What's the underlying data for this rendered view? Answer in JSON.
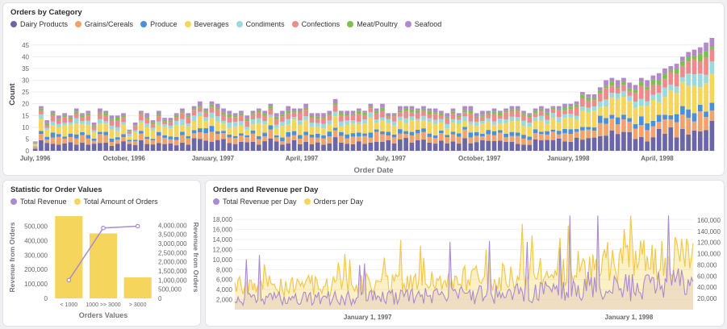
{
  "top": {
    "title": "Orders by Category",
    "legend": [
      {
        "label": "Dairy Products",
        "color": "#6b66a8"
      },
      {
        "label": "Grains/Cereals",
        "color": "#f2a36b"
      },
      {
        "label": "Produce",
        "color": "#4a90d9"
      },
      {
        "label": "Beverages",
        "color": "#f6d55c"
      },
      {
        "label": "Condiments",
        "color": "#9ad9dc"
      },
      {
        "label": "Confections",
        "color": "#ee8a8a"
      },
      {
        "label": "Meat/Poultry",
        "color": "#7fbf50"
      },
      {
        "label": "Seafood",
        "color": "#b389cc"
      }
    ]
  },
  "left": {
    "title": "Statistic for Order Values",
    "legend": [
      {
        "label": "Total Revenue",
        "color": "#a98bd0"
      },
      {
        "label": "Total Amount of Orders",
        "color": "#f6d55c"
      }
    ]
  },
  "right": {
    "title": "Orders and Revenue per Day",
    "legend": [
      {
        "label": "Total Revenue per Day",
        "color": "#a98bd0"
      },
      {
        "label": "Orders per Day",
        "color": "#f6d55c"
      }
    ]
  },
  "chart_data": [
    {
      "type": "bar",
      "stacked": true,
      "title": "Orders by Category",
      "xlabel": "Order Date",
      "ylabel": "Count",
      "ylim": [
        0,
        48
      ],
      "y_ticks": [
        0,
        5,
        10,
        15,
        20,
        25,
        30,
        35,
        40,
        45
      ],
      "x_tick_labels": [
        "July, 1996",
        "October, 1996",
        "January, 1997",
        "April, 1997",
        "July, 1997",
        "October, 1997",
        "January, 1998",
        "April, 1998"
      ],
      "series_names": [
        "Dairy Products",
        "Grains/Cereals",
        "Produce",
        "Beverages",
        "Condiments",
        "Confections",
        "Meat/Poultry",
        "Seafood"
      ],
      "totals": [
        4,
        19,
        13,
        17,
        15,
        16,
        15,
        18,
        16,
        17,
        12,
        18,
        17,
        15,
        15,
        16,
        9,
        12,
        17,
        16,
        13,
        17,
        14,
        14,
        16,
        18,
        16,
        19,
        21,
        18,
        21,
        20,
        18,
        17,
        16,
        17,
        15,
        17,
        18,
        17,
        20,
        16,
        17,
        19,
        18,
        18,
        20,
        16,
        16,
        16,
        17,
        22,
        17,
        17,
        17,
        18,
        17,
        20,
        18,
        20,
        16,
        16,
        19,
        19,
        19,
        18,
        19,
        18,
        18,
        17,
        16,
        18,
        16,
        19,
        19,
        16,
        17,
        17,
        18,
        17,
        18,
        19,
        19,
        17,
        16,
        18,
        19,
        18,
        19,
        19,
        20,
        20,
        21,
        25,
        24,
        24,
        27,
        30,
        31,
        30,
        31,
        29,
        28,
        31,
        30,
        32,
        33,
        35,
        36,
        37,
        40,
        42,
        43,
        44,
        46,
        48
      ]
    },
    {
      "type": "bar",
      "title": "Statistic for Order Values",
      "xlabel": "Orders Values",
      "ylabel": "Revenue from Orders",
      "y2label": "Revenue from Orders",
      "categories": [
        "< 1000",
        "1000 >> 3000",
        "> 3000"
      ],
      "series": [
        {
          "name": "Total Amount of Orders",
          "values": [
            570000,
            450000,
            145000
          ]
        },
        {
          "name": "Total Revenue",
          "values": [
            1000000,
            3850000,
            3950000
          ],
          "type": "line"
        }
      ],
      "ylim": [
        0,
        570000
      ],
      "y2lim": [
        0,
        4500000
      ],
      "y_ticks": [
        "0",
        "100,000",
        "200,000",
        "300,000",
        "400,000",
        "500,000"
      ],
      "y2_ticks": [
        "0",
        "500,000",
        "1,000,000",
        "1,500,000",
        "2,000,000",
        "2,500,000",
        "3,000,000",
        "3,500,000",
        "4,000,000"
      ]
    },
    {
      "type": "area",
      "title": "Orders and Revenue per Day",
      "series_names": [
        "Total Revenue per Day",
        "Orders per Day"
      ],
      "ylim": [
        0,
        19000
      ],
      "y2lim": [
        0,
        170000
      ],
      "y_ticks": [
        "2,000",
        "4,000",
        "6,000",
        "8,000",
        "10,000",
        "12,000",
        "14,000",
        "16,000",
        "18,000"
      ],
      "y2_ticks": [
        "20,000",
        "40,000",
        "60,000",
        "80,000",
        "100,000",
        "120,000",
        "140,000",
        "160,000"
      ],
      "x_tick_labels": [
        "January 1, 1997",
        "January 1, 1998"
      ]
    }
  ]
}
